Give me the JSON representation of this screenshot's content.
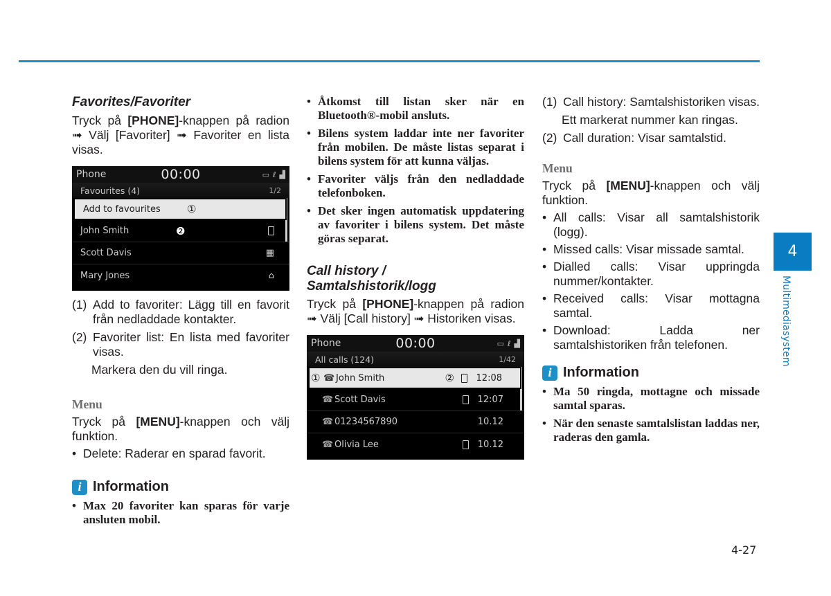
{
  "page": {
    "chapter_number": "4",
    "chapter_label": "Multimediasystem",
    "page_number": "4-27",
    "accent_color": "#1e8fc6"
  },
  "favorites": {
    "heading": "Favorites/Favoriter",
    "intro_pre": "Tryck på ",
    "intro_key": "[PHONE]",
    "intro_post": "-knappen på radion ➟ Välj [Favoriter] ➟ Favoriter en lista visas.",
    "screen": {
      "title": "Phone",
      "time": "00:00",
      "list_title": "Favourites (4)",
      "page_indicator": "1/2",
      "rows": [
        {
          "label": "Add to favourites",
          "marker": "①",
          "icon": ""
        },
        {
          "label": "John Smith",
          "marker": "❷",
          "icon": "mobile"
        },
        {
          "label": "Scott Davis",
          "marker": "",
          "icon": "office"
        },
        {
          "label": "Mary Jones",
          "marker": "",
          "icon": "home"
        }
      ]
    },
    "legend": [
      {
        "num": "(1)",
        "text": "Add to favoriter: Lägg till en favorit från nedladdade kontakter."
      },
      {
        "num": "(2)",
        "text": "Favoriter list: En lista med favoriter visas."
      }
    ],
    "legend_note": "Markera den du vill ringa.",
    "menu": {
      "heading": "Menu",
      "intro_pre": "Tryck på ",
      "intro_key": "[MENU]",
      "intro_post": "-knappen och välj funktion.",
      "items": [
        "Delete: Raderar en sparad favorit."
      ]
    },
    "info": {
      "title": "Information",
      "items": [
        "Max 20 favoriter kan sparas för varje ansluten mobil."
      ]
    },
    "notes": [
      "Åtkomst till listan sker när en Bluetooth®-mobil ansluts.",
      "Bilens system laddar inte ner favoriter från mobilen. De måste listas separat i bilens system för att kunna väljas.",
      "Favoriter väljs från den nedladdade telefonboken.",
      "Det sker ingen automatisk uppdatering av favoriter i bilens system. Det måste göras separat."
    ]
  },
  "call_history": {
    "heading_line1": "Call history /",
    "heading_line2": "Samtalshistorik/logg",
    "intro_pre": "Tryck på ",
    "intro_key": "[PHONE]",
    "intro_post": "-knappen på radion ➟ Välj [Call history] ➟ Historiken visas.",
    "screen": {
      "title": "Phone",
      "time": "00:00",
      "list_title": "All calls (124)",
      "page_indicator": "1/42",
      "rows": [
        {
          "label": "John Smith",
          "marker_left": "①",
          "marker_right": "②",
          "device": "mobile",
          "time": "12:08",
          "call_icon": "outgoing"
        },
        {
          "label": "Scott Davis",
          "marker_left": "",
          "marker_right": "",
          "device": "mobile",
          "time": "12:07",
          "call_icon": "outgoing"
        },
        {
          "label": "01234567890",
          "marker_left": "",
          "marker_right": "",
          "device": "",
          "time": "10.12",
          "call_icon": "incoming"
        },
        {
          "label": "Olivia Lee",
          "marker_left": "",
          "marker_right": "",
          "device": "mobile",
          "time": "10.12",
          "call_icon": "incoming"
        }
      ]
    },
    "legend": [
      {
        "num": "(1)",
        "text": "Call history: Samtalshistoriken visas."
      },
      {
        "num": "(2)",
        "text": "Call duration: Visar samtalstid."
      }
    ],
    "legend_note": "Ett markerat nummer kan ringas.",
    "menu": {
      "heading": "Menu",
      "intro_pre": "Tryck på ",
      "intro_key": "[MENU]",
      "intro_post": "-knappen och välj funktion.",
      "items": [
        "All calls: Visar all samtalshistorik (logg).",
        "Missed calls: Visar missade samtal.",
        "Dialled calls: Visar uppringda nummer/kontakter.",
        "Received calls: Visar mottagna samtal.",
        "Download: Ladda ner samtalshistoriken från telefonen."
      ]
    },
    "info": {
      "title": "Information",
      "items": [
        "Ma 50 ringda, mottagne och missade samtal sparas.",
        "När den senaste samtalslistan laddas ner, raderas den gamla."
      ]
    }
  },
  "icons": {
    "bullet": "•",
    "handset_out": "☎",
    "home": "⌂",
    "office": "▦",
    "status_battery": "▭",
    "status_bt": "ℓ",
    "status_signal": "▟"
  }
}
